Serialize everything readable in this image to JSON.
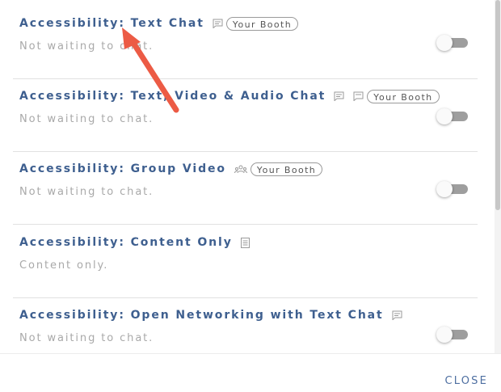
{
  "rows": [
    {
      "title": "Accessibility: Text Chat",
      "icons": [
        "chat-icon"
      ],
      "badge": "Your Booth",
      "subtitle": "Not waiting to chat.",
      "toggle": "off"
    },
    {
      "title": "Accessibility: Text, Video & Audio Chat",
      "icons": [
        "chat-icon",
        "chat-icon"
      ],
      "badge": "Your Booth",
      "subtitle": "Not waiting to chat.",
      "toggle": "off"
    },
    {
      "title": "Accessibility: Group Video",
      "icons": [
        "group-icon"
      ],
      "badge": "Your Booth",
      "subtitle": "Not waiting to chat.",
      "toggle": "off"
    },
    {
      "title": "Accessibility: Content Only",
      "icons": [
        "document-icon"
      ],
      "subtitle": "Content only."
    },
    {
      "title": "Accessibility: Open Networking with Text Chat",
      "icons": [
        "chat-icon"
      ],
      "subtitle": "Not waiting to chat.",
      "toggle": "off"
    }
  ],
  "footer": {
    "close_label": "CLOSE"
  },
  "colors": {
    "title": "#3e5f8f",
    "subtitle": "#a9a9a9",
    "toggle_off": "#9e9e9e",
    "annotation_arrow": "#ec5b45"
  }
}
